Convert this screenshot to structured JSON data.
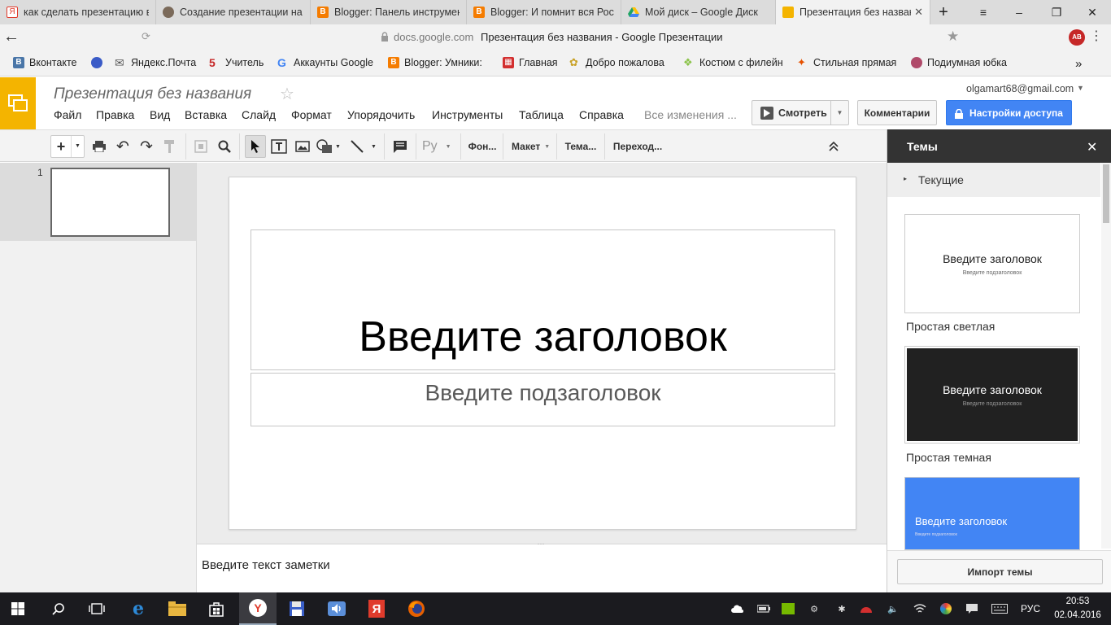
{
  "browser": {
    "tabs": [
      {
        "title": "как сделать презентацию в",
        "fav_color": "#e03b2c",
        "fav_text": "Я"
      },
      {
        "title": "Создание презентации на Д",
        "fav_color": "#7b6a5a",
        "fav_text": ""
      },
      {
        "title": "Blogger: Панель инструмент",
        "fav_color": "#f57c00",
        "fav_text": "B"
      },
      {
        "title": "Blogger: И помнит вся Росси",
        "fav_color": "#f57c00",
        "fav_text": "B"
      },
      {
        "title": "Мой диск – Google Диск",
        "fav_color": "#1fa463",
        "fav_text": ""
      },
      {
        "title": "Презентация без назван",
        "fav_color": "#f4b400",
        "fav_text": ""
      }
    ],
    "new_tab": "+",
    "window_controls": {
      "menu": "≡",
      "minimize": "–",
      "maximize": "❐",
      "close": "✕"
    },
    "address": {
      "domain": "docs.google.com",
      "page_title": "Презентация без названия - Google Презентации"
    },
    "bookmarks": [
      {
        "label": "Вконтакте",
        "color": "#4a76a8",
        "glyph": "В"
      },
      {
        "label": "",
        "color": "#3a5bc7",
        "glyph": "●"
      },
      {
        "label": "Яндекс.Почта",
        "color": "#555",
        "glyph": "✉"
      },
      {
        "label": "Учитель",
        "color": "#c62828",
        "glyph": "5"
      },
      {
        "label": "Аккаунты Google",
        "color": "#4285f4",
        "glyph": "G"
      },
      {
        "label": "Blogger: Умники: ",
        "color": "#f57c00",
        "glyph": "B"
      },
      {
        "label": "Главная",
        "color": "#d32f2f",
        "glyph": "▦"
      },
      {
        "label": "Добро пожалова",
        "color": "#c9a227",
        "glyph": "✿"
      },
      {
        "label": "Костюм с филейн",
        "color": "#8bc34a",
        "glyph": "❖"
      },
      {
        "label": "Стильная прямая",
        "color": "#e65100",
        "glyph": "✦"
      },
      {
        "label": "Подиумная юбка",
        "color": "#b04a6a",
        "glyph": "●"
      }
    ],
    "bookmarks_more": "»"
  },
  "app": {
    "title": "Презентация без названия",
    "star": "☆",
    "account": "olgamart68@gmail.com",
    "menus": [
      "Файл",
      "Правка",
      "Вид",
      "Вставка",
      "Слайд",
      "Формат",
      "Упорядочить",
      "Инструменты",
      "Таблица",
      "Справка"
    ],
    "save_status": "Все изменения ...",
    "present_label": "Смотреть",
    "comments_label": "Комментарии",
    "share_label": "Настройки доступа",
    "accent": "#f4b400",
    "share_color": "#4285f4"
  },
  "toolbar": {
    "font_label": "Ру",
    "background_label": "Фон...",
    "layout_label": "Макет",
    "theme_label": "Тема...",
    "transition_label": "Переход..."
  },
  "filmstrip": {
    "slide_number": "1"
  },
  "slide": {
    "title_placeholder": "Введите заголовок",
    "subtitle_placeholder": "Введите подзаголовок"
  },
  "notes": {
    "placeholder": "Введите текст заметки"
  },
  "themes_panel": {
    "title": "Темы",
    "close": "✕",
    "current_label": "Текущие",
    "themes": [
      {
        "name": "Простая светлая",
        "card_title": "Введите заголовок",
        "card_subtitle": "Введите подзаголовок",
        "bg": "#ffffff",
        "fg": "#222222"
      },
      {
        "name": "Простая темная",
        "card_title": "Введите заголовок",
        "card_subtitle": "Введите подзаголовок",
        "bg": "#212121",
        "fg": "#ffffff"
      },
      {
        "name": "",
        "card_title": "Введите заголовок",
        "card_subtitle": "Введите подзаголовок",
        "bg": "#4285f4",
        "fg": "#ffffff"
      }
    ],
    "import_label": "Импорт темы"
  },
  "taskbar": {
    "language": "РУС",
    "time": "20:53",
    "date": "02.04.2016"
  }
}
